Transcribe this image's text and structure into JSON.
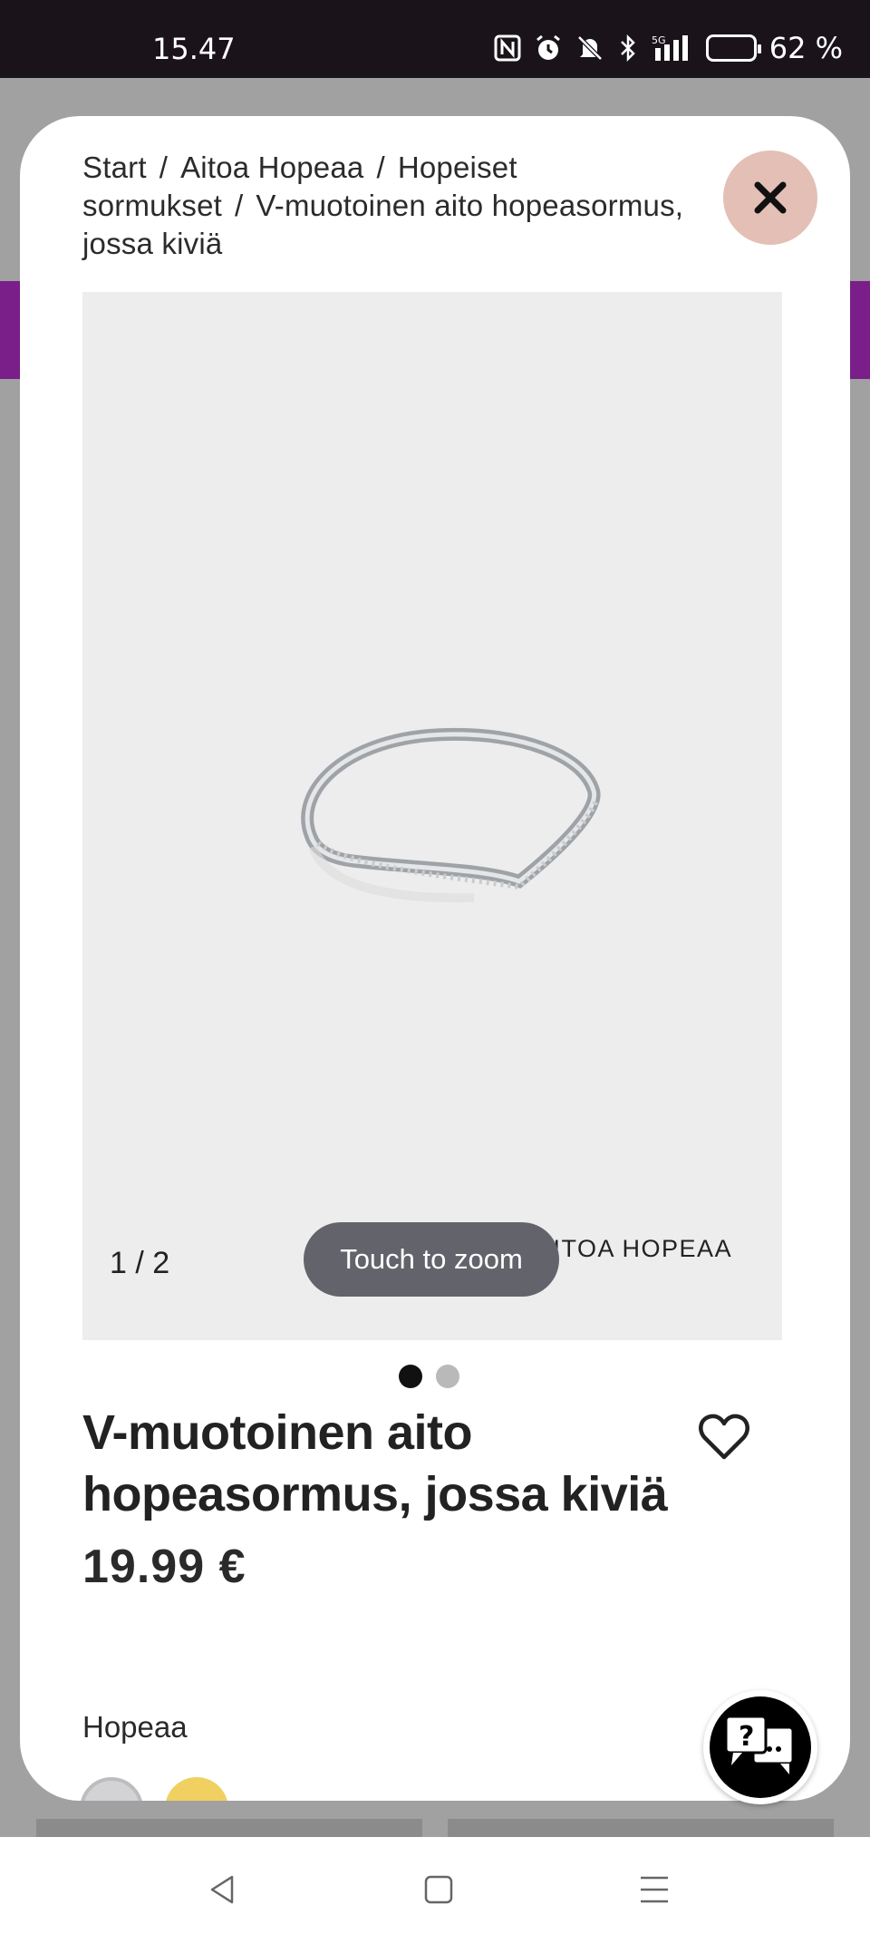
{
  "status_bar": {
    "time": "15.47",
    "battery_percent": "62 %",
    "battery_level": 0.62,
    "icons": [
      "nfc-icon",
      "alarm-icon",
      "silent-icon",
      "bluetooth-icon",
      "signal-5g-icon",
      "battery-icon"
    ]
  },
  "breadcrumb": {
    "items": [
      "Start",
      "Aitoa Hopeaa",
      "Hopeiset sormukset",
      "V-muotoinen aito hopeasormus, jossa kiviä"
    ],
    "separator": "/"
  },
  "gallery": {
    "counter": "1 / 2",
    "zoom_hint": "Touch to zoom",
    "watermark": "AITOA HOPEAA",
    "total_images": 2,
    "active_index": 1
  },
  "product": {
    "title": "V-muotoinen aito hopeasormus, jossa kiviä",
    "price": "19.99 €",
    "color_label": "Hopeaa",
    "swatch_colors": [
      "#d3d3d6",
      "#f0d060"
    ]
  },
  "help": {
    "icon": "help-chat-icon"
  },
  "nav": {
    "icons": [
      "back-icon",
      "home-icon",
      "menu-icon"
    ]
  },
  "colors": {
    "close_bg": "#e3bfb6",
    "brand_purple": "#7a1f8a",
    "gallery_bg": "#ededee"
  }
}
